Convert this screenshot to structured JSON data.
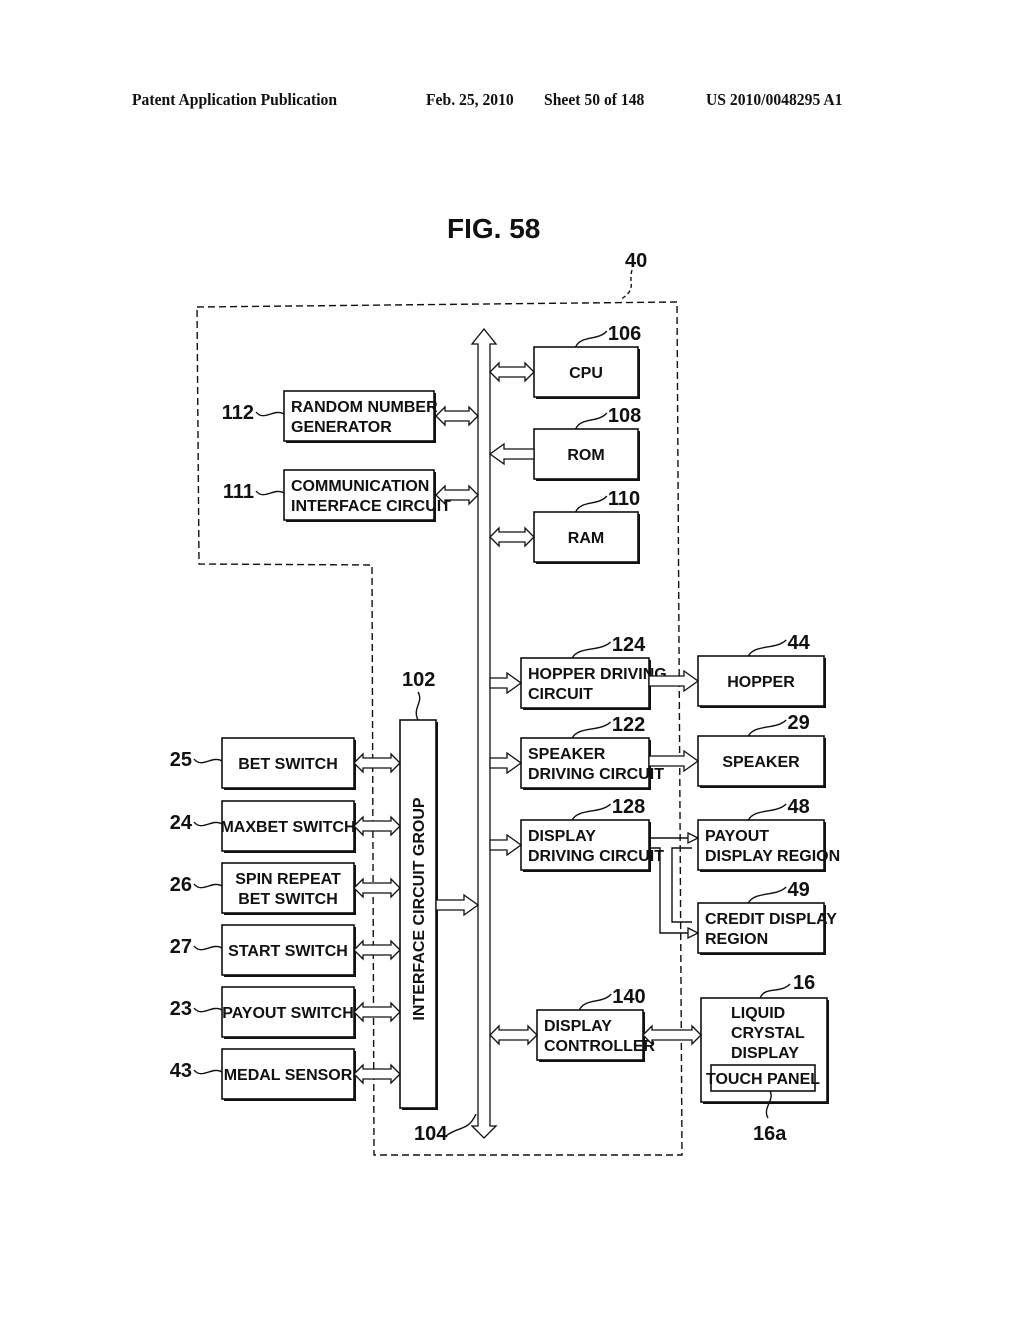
{
  "header": {
    "publication": "Patent Application Publication",
    "date": "Feb. 25, 2010",
    "sheet": "Sheet 50 of 148",
    "number": "US 2010/0048295 A1"
  },
  "figure": {
    "title": "FIG. 58",
    "boundary_ref": "40",
    "bus_ref": "104",
    "blocks": {
      "cpu": {
        "ref": "106",
        "lines": [
          "CPU"
        ]
      },
      "rom": {
        "ref": "108",
        "lines": [
          "ROM"
        ]
      },
      "ram": {
        "ref": "110",
        "lines": [
          "RAM"
        ]
      },
      "rng": {
        "ref": "112",
        "lines": [
          "RANDOM NUMBER",
          "GENERATOR"
        ]
      },
      "comm": {
        "ref": "111",
        "lines": [
          "COMMUNICATION",
          "INTERFACE CIRCUIT"
        ]
      },
      "icg": {
        "ref": "102",
        "lines": [
          "INTERFACE CIRCUIT GROUP"
        ]
      },
      "hopper_drv": {
        "ref": "124",
        "lines": [
          "HOPPER DRIVING",
          "CIRCUIT"
        ]
      },
      "speaker_drv": {
        "ref": "122",
        "lines": [
          "SPEAKER",
          "DRIVING CIRCUIT"
        ]
      },
      "display_drv": {
        "ref": "128",
        "lines": [
          "DISPLAY",
          "DRIVING CIRCUIT"
        ]
      },
      "display_ctrl": {
        "ref": "140",
        "lines": [
          "DISPLAY",
          "CONTROLLER"
        ]
      },
      "hopper": {
        "ref": "44",
        "lines": [
          "HOPPER"
        ]
      },
      "speaker": {
        "ref": "29",
        "lines": [
          "SPEAKER"
        ]
      },
      "payout_disp": {
        "ref": "48",
        "lines": [
          "PAYOUT",
          "DISPLAY REGION"
        ]
      },
      "credit_disp": {
        "ref": "49",
        "lines": [
          "CREDIT DISPLAY",
          "REGION"
        ]
      },
      "lcd": {
        "ref": "16",
        "lines": [
          "LIQUID",
          "CRYSTAL",
          "DISPLAY"
        ]
      },
      "touch": {
        "ref": "16a",
        "lines": [
          "TOUCH PANEL"
        ]
      },
      "bet": {
        "ref": "25",
        "lines": [
          "BET SWITCH"
        ]
      },
      "maxbet": {
        "ref": "24",
        "lines": [
          "MAXBET SWITCH"
        ]
      },
      "spin": {
        "ref": "26",
        "lines": [
          "SPIN REPEAT",
          "BET SWITCH"
        ]
      },
      "start": {
        "ref": "27",
        "lines": [
          "START SWITCH"
        ]
      },
      "payout_sw": {
        "ref": "23",
        "lines": [
          "PAYOUT SWITCH"
        ]
      },
      "medal": {
        "ref": "43",
        "lines": [
          "MEDAL SENSOR"
        ]
      }
    }
  }
}
